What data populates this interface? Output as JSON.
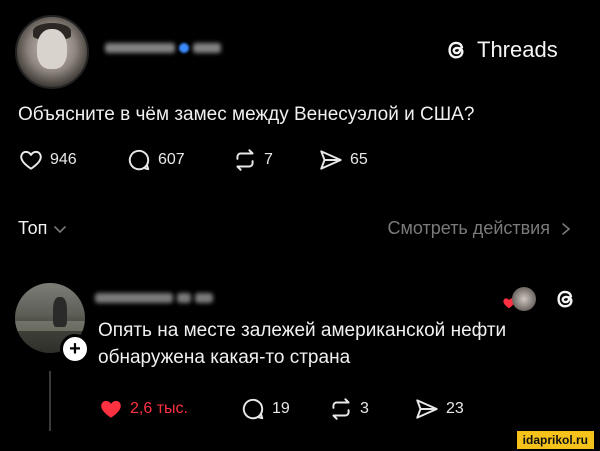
{
  "post": {
    "brand": "Threads",
    "text": "Объясните в чём замес между Венесуэлой и США?",
    "likes": "946",
    "comments": "607",
    "reposts": "7",
    "shares": "65"
  },
  "filters": {
    "sort_label": "Топ",
    "view_activity": "Смотреть действия"
  },
  "reply": {
    "text": "Опять на месте залежей американской нефти обнаружена какая-то страна",
    "likes": "2,6 тыс.",
    "comments": "19",
    "reposts": "3",
    "shares": "23",
    "add_symbol": "+"
  },
  "watermark": "idaprikol.ru",
  "colors": {
    "like_active": "#ff3040",
    "verified": "#3d8bff",
    "watermark_bg": "#f4c21a"
  }
}
